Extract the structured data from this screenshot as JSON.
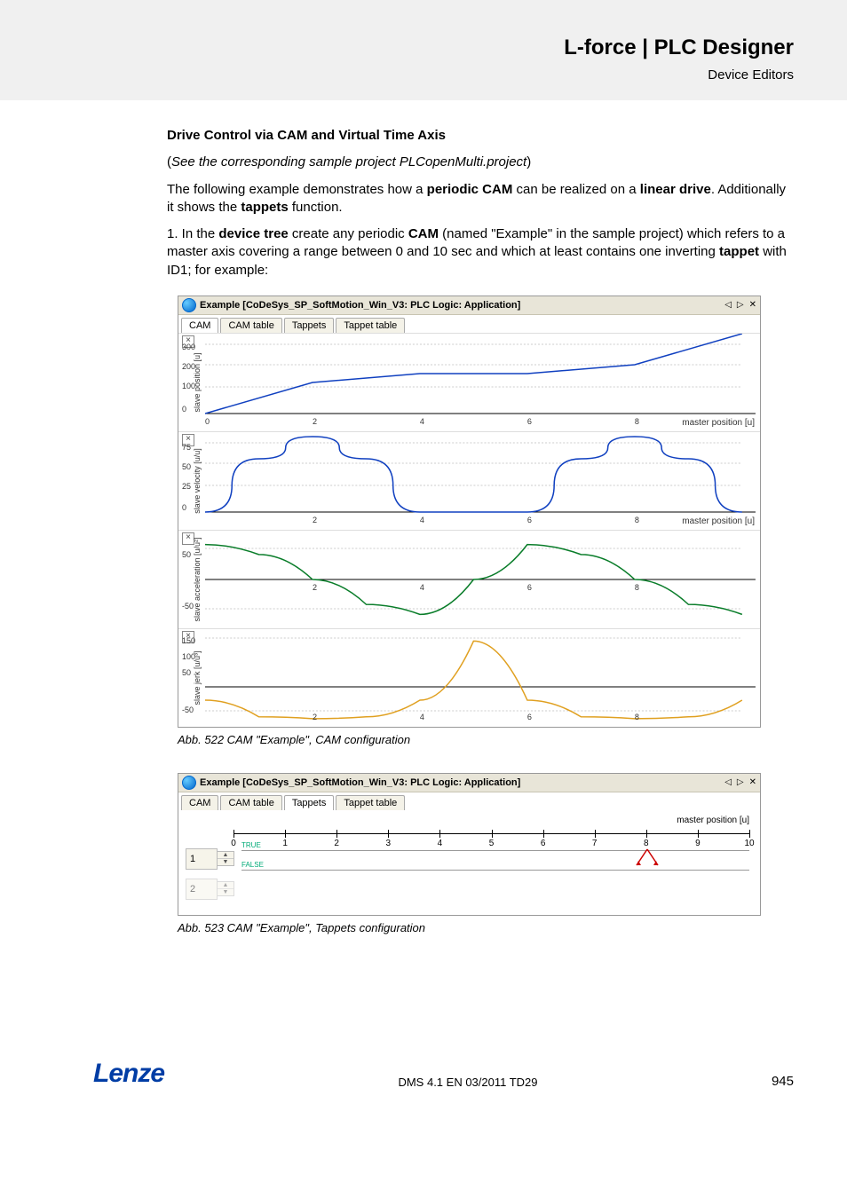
{
  "header": {
    "title": "L-force | PLC Designer",
    "subtitle": "Device Editors"
  },
  "body": {
    "heading": "Drive Control via CAM and Virtual Time Axis",
    "subnote_open": "(",
    "subnote_text": "See the corresponding sample project PLCopenMulti.project",
    "subnote_close": ")",
    "para1_a": "The following example demonstrates how a ",
    "para1_b": "periodic CAM",
    "para1_c": " can be realized on a ",
    "para1_d": "linear drive",
    "para1_e": ". Additionally it shows the ",
    "para1_f": "tappets",
    "para1_g": " function.",
    "para2_a": "1. In the ",
    "para2_b": "device tree",
    "para2_c": " create any periodic ",
    "para2_d": "CAM",
    "para2_e": " (named \"Example\" in the sample project) which refers to a master axis covering a range between 0 and 10 sec and which at least contains one inverting ",
    "para2_f": "tappet",
    "para2_g": " with ID1; for example:"
  },
  "fig1": {
    "window_title": "Example [CoDeSys_SP_SoftMotion_Win_V3: PLC Logic: Application]",
    "tabs": [
      "CAM",
      "CAM table",
      "Tappets",
      "Tappet table"
    ],
    "active_tab": 0,
    "x_axis_label": "master position [u]",
    "plots": [
      {
        "title": "slave position [u]",
        "ylabels": [
          "300",
          "200",
          "100",
          "0"
        ]
      },
      {
        "title": "slave velocity [u/u]",
        "ylabels": [
          "75",
          "50",
          "25",
          "0"
        ]
      },
      {
        "title": "slave acceleration [u/u²]",
        "ylabels": [
          "50",
          "",
          "-50"
        ]
      },
      {
        "title": "slave jerk [u/u³]",
        "ylabels": [
          "150",
          "100",
          "50",
          "",
          "-50"
        ]
      }
    ],
    "xticks": [
      "0",
      "2",
      "4",
      "6",
      "8"
    ],
    "caption": "Abb. 522     CAM \"Example\", CAM configuration"
  },
  "chart_data": [
    {
      "type": "line",
      "title": "slave position [u]",
      "xlabel": "master position [u]",
      "x": [
        0,
        2,
        4,
        6,
        8,
        10
      ],
      "values": [
        0,
        140,
        180,
        180,
        220,
        360
      ],
      "ylim": [
        0,
        360
      ]
    },
    {
      "type": "line",
      "title": "slave velocity [u/u]",
      "xlabel": "master position [u]",
      "x": [
        0,
        1,
        2,
        3,
        4,
        5,
        6,
        7,
        8,
        9,
        10
      ],
      "values": [
        0,
        60,
        85,
        60,
        0,
        0,
        0,
        60,
        85,
        60,
        0
      ],
      "ylim": [
        0,
        90
      ]
    },
    {
      "type": "line",
      "title": "slave acceleration [u/u²]",
      "xlabel": "master position [u]",
      "x": [
        0,
        1,
        2,
        3,
        4,
        5,
        6,
        7,
        8,
        9,
        10
      ],
      "values": [
        70,
        50,
        0,
        -50,
        -70,
        0,
        70,
        50,
        0,
        -50,
        -70
      ],
      "ylim": [
        -80,
        80
      ]
    },
    {
      "type": "line",
      "title": "slave jerk [u/u³]",
      "xlabel": "master position [u]",
      "x": [
        0,
        1,
        2,
        3,
        4,
        5,
        6,
        7,
        8,
        9,
        10
      ],
      "values": [
        -10,
        -55,
        -60,
        -55,
        -10,
        150,
        -10,
        -55,
        -60,
        -55,
        -10
      ],
      "ylim": [
        -70,
        170
      ]
    }
  ],
  "fig2": {
    "window_title": "Example [CoDeSys_SP_SoftMotion_Win_V3: PLC Logic: Application]",
    "tabs": [
      "CAM",
      "CAM table",
      "Tappets",
      "Tappet table"
    ],
    "active_tab": 2,
    "mp_label": "master position [u]",
    "xticks": [
      "0",
      "1",
      "2",
      "3",
      "4",
      "5",
      "6",
      "7",
      "8",
      "9",
      "10"
    ],
    "rows": [
      {
        "id": "1",
        "active": true,
        "true_label": "TRUE",
        "false_label": "FALSE",
        "marker_x": 8
      },
      {
        "id": "2",
        "active": false
      }
    ],
    "caption": "Abb. 523     CAM \"Example\", Tappets configuration"
  },
  "footer": {
    "logo": "Lenze",
    "center": "DMS 4.1 EN 03/2011 TD29",
    "page": "945"
  }
}
